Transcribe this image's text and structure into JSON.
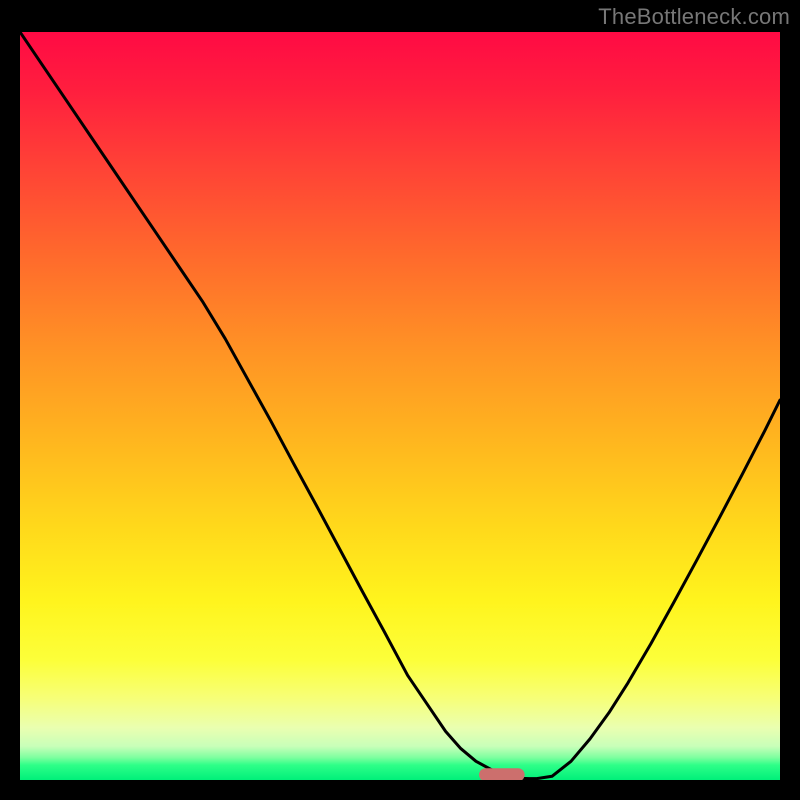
{
  "watermark": "TheBottleneck.com",
  "colors": {
    "page_bg": "#000000",
    "curve": "#000000",
    "marker": "#cc6f6d",
    "gradient_stops": [
      "#ff0a44",
      "#ff1f3e",
      "#ff4236",
      "#ff6a2c",
      "#ff9125",
      "#ffb41f",
      "#ffd81b",
      "#fff41d",
      "#fcff3a",
      "#f7ff77",
      "#eaffb0",
      "#c8ffb9",
      "#7dff9f",
      "#2eff88",
      "#00f07a"
    ]
  },
  "chart_data": {
    "type": "line",
    "title": "",
    "xlabel": "",
    "ylabel": "",
    "xlim": [
      0,
      100
    ],
    "ylim": [
      0,
      100
    ],
    "x": [
      0,
      3,
      6,
      9,
      12,
      15,
      18,
      21,
      24,
      27,
      30,
      33,
      36,
      39,
      42,
      45,
      48,
      51,
      54,
      56,
      58,
      60,
      62,
      63,
      64,
      65,
      66,
      67,
      68,
      70,
      72.5,
      75,
      77.5,
      80,
      83,
      86,
      89,
      92,
      95,
      98,
      100
    ],
    "y": [
      100,
      95.5,
      91,
      86.5,
      82,
      77.5,
      73,
      68.5,
      64,
      59,
      53.5,
      48,
      42.3,
      36.7,
      31,
      25.3,
      19.7,
      14,
      9.5,
      6.5,
      4.2,
      2.5,
      1.4,
      0.95,
      0.6,
      0.35,
      0.22,
      0.18,
      0.18,
      0.5,
      2.5,
      5.5,
      9,
      13,
      18.2,
      23.7,
      29.3,
      35,
      40.8,
      46.7,
      50.8
    ],
    "marker": {
      "x_center": 63.4,
      "y": 0.7,
      "width": 6
    },
    "notes": "V-shaped bottleneck curve with minimum at ~x=63–67, y≈0; background gradient encodes value red→yellow→green top→bottom."
  }
}
